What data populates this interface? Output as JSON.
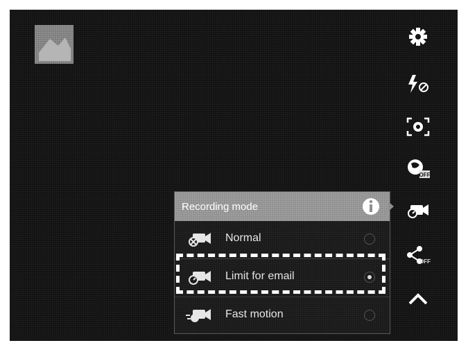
{
  "gallery": {
    "thumbnail_icon": "image-thumbnail"
  },
  "sidebar": {
    "items": [
      {
        "name": "settings",
        "icon": "gear-icon"
      },
      {
        "name": "flash",
        "icon": "flash-off-icon"
      },
      {
        "name": "auto-focus",
        "icon": "face-detect-icon"
      },
      {
        "name": "gps",
        "icon": "gps-off-icon",
        "badge": "OFF"
      },
      {
        "name": "recording-mode",
        "icon": "video-camera-icon"
      },
      {
        "name": "share",
        "icon": "share-off-icon",
        "badge": "OFF"
      },
      {
        "name": "collapse",
        "icon": "chevron-up-icon"
      }
    ]
  },
  "recording_panel": {
    "title": "Recording mode",
    "info_icon": "info-icon",
    "options": [
      {
        "label": "Normal",
        "icon": "video-normal-icon",
        "selected": false
      },
      {
        "label": "Limit for email",
        "icon": "video-email-icon",
        "selected": true
      },
      {
        "label": "Fast motion",
        "icon": "video-fast-icon",
        "selected": false
      }
    ]
  },
  "colors": {
    "screen_bg": "#141414",
    "text": "#ffffff",
    "highlight": "#ffffff"
  }
}
